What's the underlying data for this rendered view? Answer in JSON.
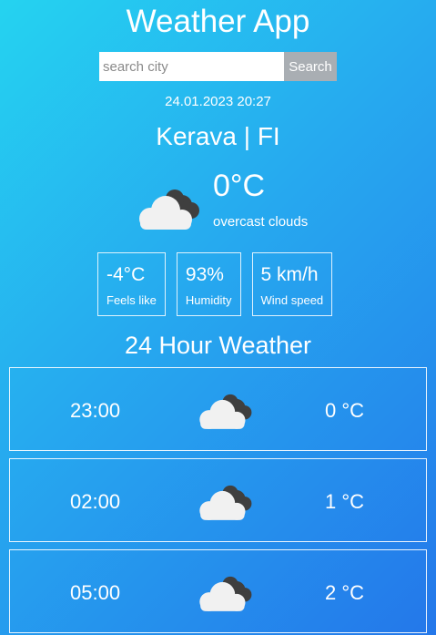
{
  "app": {
    "title": "Weather App"
  },
  "search": {
    "placeholder": "search city",
    "button_label": "Search"
  },
  "current": {
    "datetime": "24.01.2023 20:27",
    "location": "Kerava | FI",
    "temperature": "0°C",
    "description": "overcast clouds",
    "icon": "overcast-clouds-icon"
  },
  "stats": [
    {
      "value": "-4°C",
      "label": "Feels like"
    },
    {
      "value": "93%",
      "label": "Humidity"
    },
    {
      "value": "5 km/h",
      "label": "Wind speed"
    }
  ],
  "forecast": {
    "title": "24 Hour Weather",
    "items": [
      {
        "time": "23:00",
        "temp": "0 °C",
        "icon": "overcast-clouds-icon"
      },
      {
        "time": "02:00",
        "temp": "1 °C",
        "icon": "overcast-clouds-icon"
      },
      {
        "time": "05:00",
        "temp": "2 °C",
        "icon": "overcast-clouds-icon"
      }
    ]
  }
}
